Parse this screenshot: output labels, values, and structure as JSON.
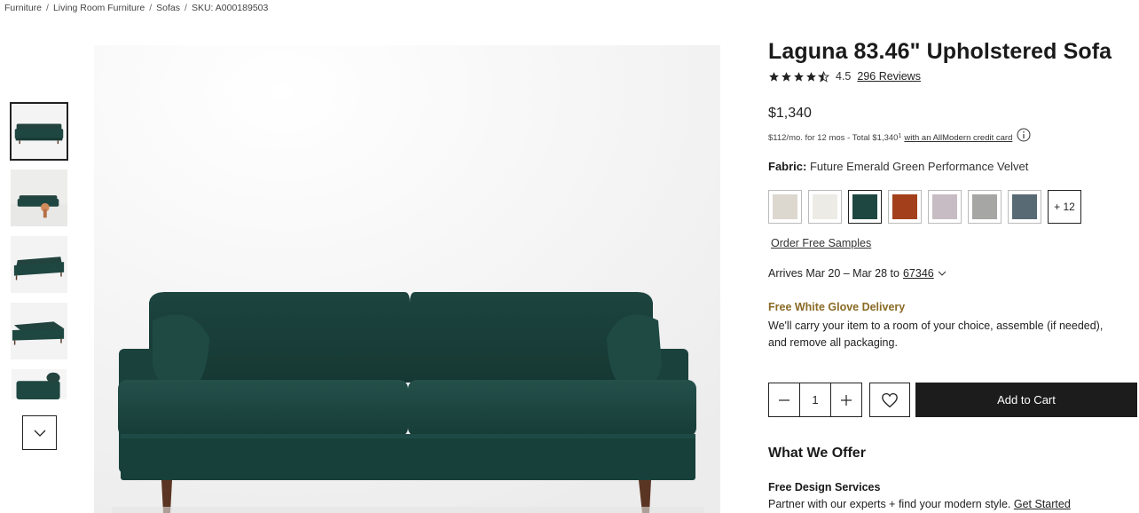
{
  "breadcrumb": {
    "items": [
      "Furniture",
      "Living Room Furniture",
      "Sofas",
      "SKU: A000189503"
    ],
    "separator": "/"
  },
  "gallery": {
    "thumbnails": [
      {
        "label": "front view",
        "active": true
      },
      {
        "label": "styled room view",
        "active": false
      },
      {
        "label": "angled view",
        "active": false
      },
      {
        "label": "side angle view",
        "active": false
      },
      {
        "label": "arm detail view",
        "active": false
      }
    ],
    "scroll_icon": "chevron-down-icon"
  },
  "product": {
    "title": "Laguna 83.46\" Upholstered Sofa",
    "rating": "4.5",
    "rating_value": 4.5,
    "reviews_label": "296 Reviews",
    "price": "$1,340",
    "finance_text": "$112/mo. for 12 mos - Total $1,340",
    "finance_sup": "1",
    "finance_link": "with an AllModern credit card",
    "fabric_label": "Fabric:",
    "fabric_value": "Future Emerald Green Performance Velvet",
    "swatches": [
      {
        "name": "oatmeal",
        "color": "#dcd8d0"
      },
      {
        "name": "ivory",
        "color": "#ecebe6"
      },
      {
        "name": "emerald green",
        "color": "#1f4742",
        "selected": true
      },
      {
        "name": "rust",
        "color": "#a3401b"
      },
      {
        "name": "lavender grey",
        "color": "#c8bcc4"
      },
      {
        "name": "grey",
        "color": "#a6a6a4"
      },
      {
        "name": "slate blue",
        "color": "#586a73"
      }
    ],
    "swatches_more": "+ 12",
    "samples_link": "Order Free Samples",
    "arrives_text": "Arrives Mar 20 – Mar 28 to",
    "zip": "67346",
    "delivery_title": "Free White Glove Delivery",
    "delivery_text": "We'll carry your item to a room of your choice, assemble (if needed), and remove all packaging.",
    "quantity": "1",
    "add_to_cart": "Add to Cart"
  },
  "offers": {
    "title": "What We Offer",
    "design_title": "Free Design Services",
    "design_text": "Partner with our experts + find your modern style.",
    "design_link": "Get Started"
  },
  "colors": {
    "delivery_accent": "#8a6a25",
    "cart_button": "#1c1c1c",
    "sofa_green": "#1f4742",
    "star": "#222222"
  }
}
